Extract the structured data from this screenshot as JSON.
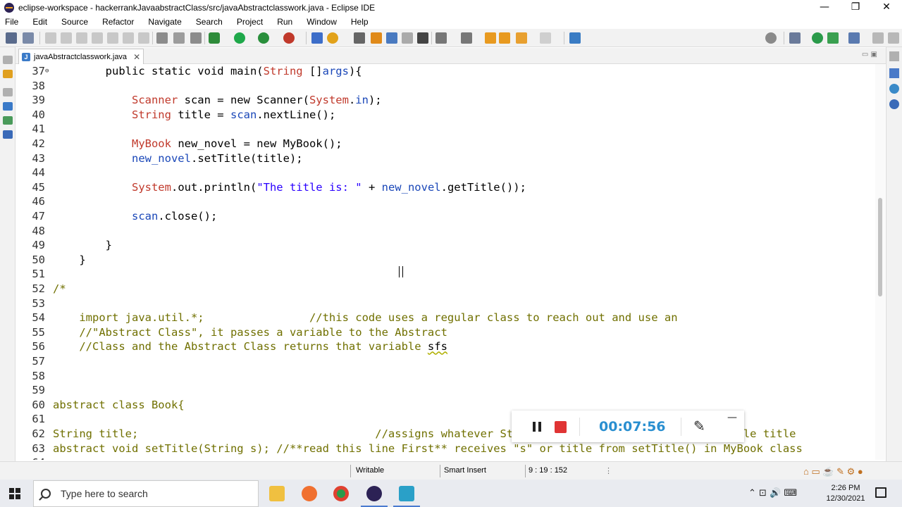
{
  "window": {
    "title": "eclipse-workspace - hackerrankJavaabstractClass/src/javaAbstractclasswork.java - Eclipse IDE",
    "controls": [
      "—",
      "❐",
      "✕"
    ]
  },
  "menu": [
    "File",
    "Edit",
    "Source",
    "Refactor",
    "Navigate",
    "Search",
    "Project",
    "Run",
    "Window",
    "Help"
  ],
  "editor_tab": {
    "label": "javaAbstractclasswork.java",
    "close": "✕"
  },
  "code": [
    {
      "n": "37",
      "fold": "⊖",
      "seg": [
        [
          "        ",
          "kw"
        ],
        [
          "public static void main(",
          "kw"
        ],
        [
          "String",
          "ty"
        ],
        [
          " []",
          "kw"
        ],
        [
          "args",
          "fld"
        ],
        [
          "){",
          "kw"
        ]
      ]
    },
    {
      "n": "38",
      "seg": []
    },
    {
      "n": "39",
      "seg": [
        [
          "            ",
          "kw"
        ],
        [
          "Scanner",
          "ty"
        ],
        [
          " scan = new Scanner(",
          "kw"
        ],
        [
          "System",
          "ty"
        ],
        [
          ".",
          "kw"
        ],
        [
          "in",
          "fld"
        ],
        [
          ");",
          "kw"
        ]
      ]
    },
    {
      "n": "40",
      "seg": [
        [
          "            ",
          "kw"
        ],
        [
          "String",
          "ty"
        ],
        [
          " title = ",
          "kw"
        ],
        [
          "scan",
          "fld"
        ],
        [
          ".nextLine();",
          "kw"
        ]
      ]
    },
    {
      "n": "41",
      "seg": []
    },
    {
      "n": "42",
      "seg": [
        [
          "            ",
          "kw"
        ],
        [
          "MyBook",
          "ty"
        ],
        [
          " new_novel = new MyBook();",
          "kw"
        ]
      ]
    },
    {
      "n": "43",
      "seg": [
        [
          "            ",
          "kw"
        ],
        [
          "new_novel",
          "fld"
        ],
        [
          ".setTitle(title);",
          "kw"
        ]
      ]
    },
    {
      "n": "44",
      "seg": []
    },
    {
      "n": "45",
      "seg": [
        [
          "            ",
          "kw"
        ],
        [
          "System",
          "ty"
        ],
        [
          ".out.println(",
          "kw"
        ],
        [
          "\"The title is: \"",
          "str"
        ],
        [
          " + ",
          "kw"
        ],
        [
          "new_novel",
          "fld"
        ],
        [
          ".getTitle());",
          "kw"
        ]
      ]
    },
    {
      "n": "46",
      "seg": []
    },
    {
      "n": "47",
      "seg": [
        [
          "            ",
          "kw"
        ],
        [
          "scan",
          "fld"
        ],
        [
          ".close();",
          "kw"
        ]
      ]
    },
    {
      "n": "48",
      "seg": []
    },
    {
      "n": "49",
      "seg": [
        [
          "        }",
          "kw"
        ]
      ]
    },
    {
      "n": "50",
      "seg": [
        [
          "    }",
          "kw"
        ]
      ]
    },
    {
      "n": "51",
      "seg": []
    },
    {
      "n": "52",
      "seg": [
        [
          "/*",
          "cm"
        ]
      ]
    },
    {
      "n": "53",
      "seg": []
    },
    {
      "n": "54",
      "seg": [
        [
          "    import java.util.*;                //this code uses a regular class to reach out and use an",
          "cm"
        ]
      ]
    },
    {
      "n": "55",
      "seg": [
        [
          "    //\"Abstract Class\", it passes a variable to the Abstract",
          "cm"
        ]
      ]
    },
    {
      "n": "56",
      "seg": [
        [
          "    //Class and the Abstract Class returns that variable ",
          "cm"
        ],
        [
          "sfs",
          "cm-squiggle"
        ]
      ]
    },
    {
      "n": "57",
      "seg": []
    },
    {
      "n": "58",
      "seg": []
    },
    {
      "n": "59",
      "seg": []
    },
    {
      "n": "60",
      "seg": [
        [
          "abstract class Book{",
          "cm"
        ]
      ]
    },
    {
      "n": "61",
      "seg": []
    },
    {
      "n": "62",
      "seg": [
        [
          "String title;                                    //assigns whatever Stri                           variable title",
          "cm"
        ]
      ]
    },
    {
      "n": "63",
      "seg": [
        [
          "abstract void setTitle(String s); //**read this line First** receives \"s\" or title from setTitle() in MyBook class",
          "cm"
        ]
      ]
    },
    {
      "n": "64",
      "seg": []
    }
  ],
  "status": {
    "writable": "Writable",
    "insert_mode": "Smart Insert",
    "position": "9 : 19 : 152"
  },
  "recorder": {
    "time": "00:07:56",
    "pen_icon": "✎",
    "minimize": "—"
  },
  "taskbar": {
    "search_placeholder": "Type here to search",
    "time": "2:26 PM",
    "date": "12/30/2021"
  },
  "colors": {
    "keyword": "#000000",
    "type": "#c0392b",
    "field": "#1a47b8",
    "string": "#2a00ff",
    "comment": "#707000",
    "accent": "#2a8fd0"
  }
}
